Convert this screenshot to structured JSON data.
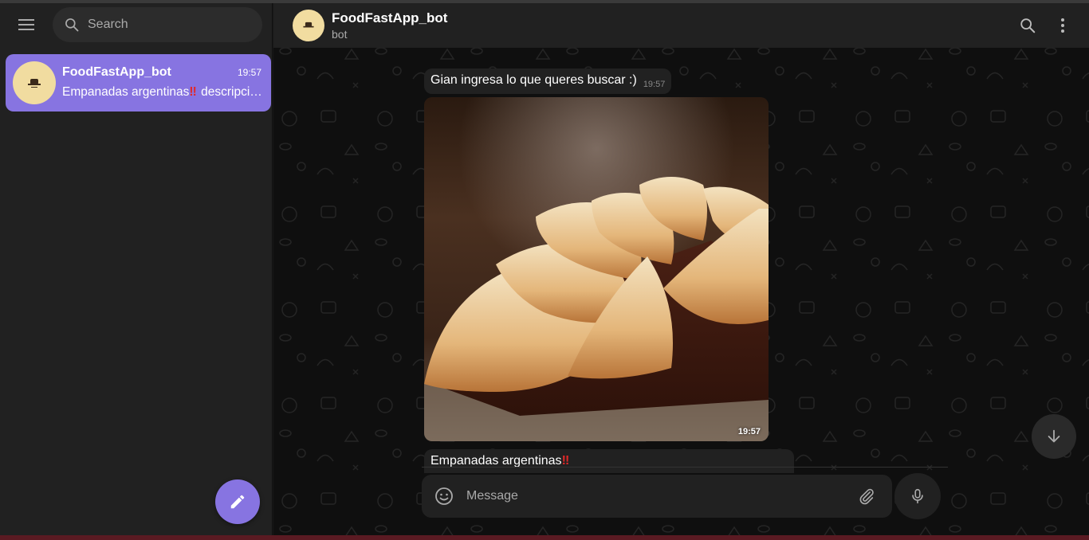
{
  "sidebar": {
    "search_placeholder": "Search",
    "chat": {
      "name": "FoodFastApp_bot",
      "time": "19:57",
      "preview_bang": "‼",
      "preview_text": "Empanadas argentinas",
      "preview_rest": " descripción"
    }
  },
  "header": {
    "title": "FoodFastApp_bot",
    "status": "bot"
  },
  "messages": {
    "text_message": "Gian ingresa lo que queres buscar :)",
    "text_time": "19:57",
    "photo_time": "19:57",
    "partial_text": "Empanadas argentinas",
    "partial_bang": "‼"
  },
  "composer": {
    "placeholder": "Message"
  },
  "colors": {
    "accent": "#8774e1",
    "avatar_bg": "#f1dca0",
    "panel": "#212121",
    "bang": "#e22828"
  },
  "icons": [
    "menu-icon",
    "search-icon",
    "pencil-icon",
    "more-vertical-icon",
    "arrow-down-icon",
    "emoji-icon",
    "paperclip-icon",
    "microphone-icon",
    "hat-icon"
  ]
}
